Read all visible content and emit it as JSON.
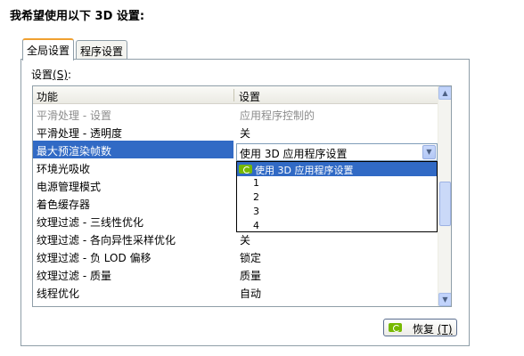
{
  "heading": "我希望使用以下 3D 设置:",
  "tabs": [
    {
      "label": "全局设置",
      "active": true
    },
    {
      "label": "程序设置",
      "active": false
    }
  ],
  "settings_label": {
    "text": "设置",
    "mnemonic": "(S)",
    "suffix": ":"
  },
  "grid": {
    "columns": [
      "功能",
      "设置"
    ],
    "rows": [
      {
        "feature": "平滑处理 - 设置",
        "value": "应用程序控制的",
        "state": "disabled"
      },
      {
        "feature": "平滑处理 - 透明度",
        "value": "关",
        "state": "normal"
      },
      {
        "feature": "最大预渲染帧数",
        "value": "",
        "state": "selected"
      },
      {
        "feature": "环境光吸收",
        "value": "",
        "state": "normal"
      },
      {
        "feature": "电源管理模式",
        "value": "",
        "state": "normal"
      },
      {
        "feature": "着色缓存器",
        "value": "",
        "state": "normal"
      },
      {
        "feature": "纹理过滤 - 三线性优化",
        "value": "",
        "state": "normal"
      },
      {
        "feature": "纹理过滤 - 各向异性采样优化",
        "value": "关",
        "state": "normal"
      },
      {
        "feature": "纹理过滤 - 负 LOD 偏移",
        "value": "锁定",
        "state": "normal"
      },
      {
        "feature": "纹理过滤 - 质量",
        "value": "质量",
        "state": "normal"
      },
      {
        "feature": "线程优化",
        "value": "自动",
        "state": "normal"
      },
      {
        "feature": "",
        "value": "",
        "state": "normal"
      }
    ]
  },
  "combo": {
    "selected": "使用 3D 应用程序设置",
    "options": [
      "使用 3D 应用程序设置",
      "1",
      "2",
      "3",
      "4"
    ],
    "highlighted_index": 0
  },
  "restore_button": {
    "label": "恢复",
    "mnemonic": "(T)"
  },
  "colors": {
    "selection": "#316ac5",
    "nvidia_green": "#76b900",
    "tab_accent": "#f0a030",
    "border": "#8f9ea8"
  },
  "icons": {
    "option_icon": "nvidia-logo-icon",
    "scroll_up": "chevron-up-icon",
    "scroll_down": "chevron-down-icon",
    "combo_arrow": "chevron-down-icon"
  }
}
